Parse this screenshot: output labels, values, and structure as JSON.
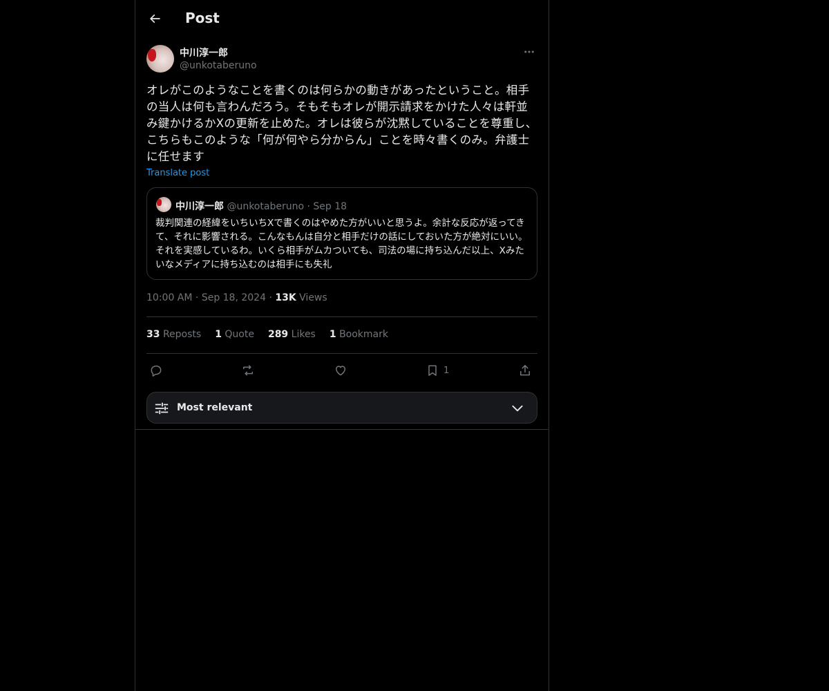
{
  "header": {
    "title": "Post",
    "back_icon": "arrow-left-icon"
  },
  "post": {
    "author_name": "中川淳一郎",
    "author_handle": "@unkotaberuno",
    "text": "オレがこのようなことを書くのは何らかの動きがあったということ。相手の当人は何も言わんだろう。そもそもオレが開示請求をかけた人々は軒並み鍵かけるかXの更新を止めた。オレは彼らが沈黙していることを尊重し、こちらもこのような「何が何やら分からん」ことを時々書くのみ。弁護士に任せます",
    "translate_label": "Translate post",
    "time": "10:00 AM",
    "date": "Sep 18, 2024",
    "views_count": "13K",
    "views_label": "Views",
    "separator": "·"
  },
  "quote": {
    "author_name": "中川淳一郎",
    "author_handle": "@unkotaberuno",
    "date": "Sep 18",
    "text": "裁判関連の経緯をいちいちXで書くのはやめた方がいいと思うよ。余計な反応が返ってきて、それに影響される。こんなもんは自分と相手だけの話にしておいた方が絶対にいい。それを実感しているわ。いくら相手がムカついても、司法の場に持ち込んだ以上、Xみたいなメディアに持ち込むのは相手にも失礼"
  },
  "stats": {
    "reposts_count": "33",
    "reposts_label": "Reposts",
    "quotes_count": "1",
    "quotes_label": "Quote",
    "likes_count": "289",
    "likes_label": "Likes",
    "bookmarks_count": "1",
    "bookmarks_label": "Bookmark"
  },
  "actions": {
    "reply_icon": "reply-icon",
    "repost_icon": "repost-icon",
    "like_icon": "heart-icon",
    "bookmark_icon": "bookmark-icon",
    "bookmark_count": "1",
    "share_icon": "share-icon"
  },
  "sort": {
    "label": "Most relevant"
  },
  "colors": {
    "background": "#000000",
    "text": "#e7e9ea",
    "muted": "#71767b",
    "accent": "#1d9bf0",
    "border": "#2f3336"
  }
}
